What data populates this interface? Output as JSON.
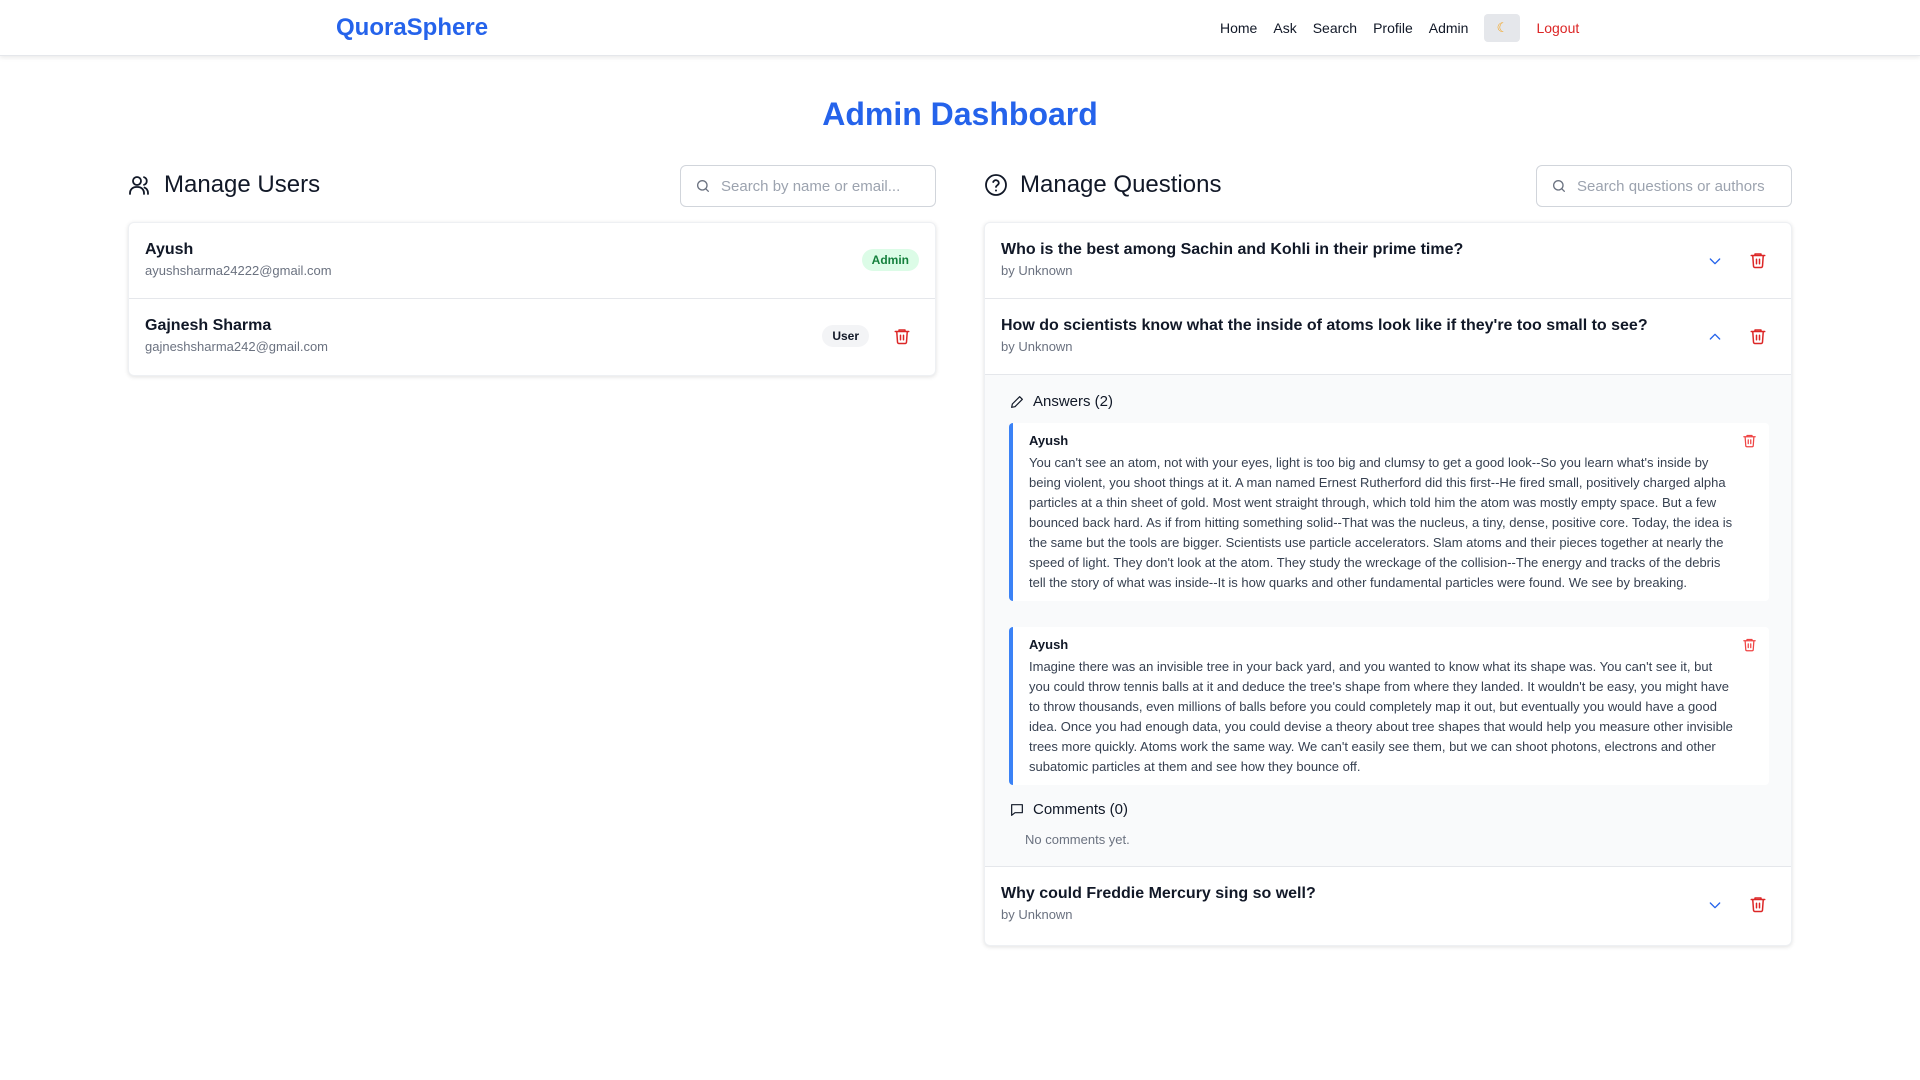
{
  "nav": {
    "brand": "QuoraSphere",
    "links": [
      "Home",
      "Ask",
      "Search",
      "Profile",
      "Admin"
    ],
    "theme_icon": "moon-icon",
    "logout": "Logout"
  },
  "page_title": "Admin Dashboard",
  "users": {
    "heading": "Manage Users",
    "search_placeholder": "Search by name or email...",
    "list": [
      {
        "name": "Ayush",
        "email": "ayushsharma24222@gmail.com",
        "role": "Admin"
      },
      {
        "name": "Gajnesh Sharma",
        "email": "gajneshsharma242@gmail.com",
        "role": "User"
      }
    ]
  },
  "questions": {
    "heading": "Manage Questions",
    "search_placeholder": "Search questions or authors",
    "list": [
      {
        "title": "Who is the best among Sachin and Kohli in their prime time?",
        "by": "by Unknown"
      },
      {
        "title": "How do scientists know what the inside of atoms look like if they're too small to see?",
        "by": "by Unknown"
      },
      {
        "title": "Why could Freddie Mercury sing so well?",
        "by": "by Unknown"
      }
    ],
    "expanded": {
      "answers_heading": "Answers (2)",
      "answers": [
        {
          "author": "Ayush",
          "text": "You can't see an atom, not with your eyes, light is too big and clumsy to get a good look--So you learn what's inside by being violent, you shoot things at it. A man named Ernest Rutherford did this first--He fired small, positively charged alpha particles at a thin sheet of gold. Most went straight through, which told him the atom was mostly empty space. But a few bounced back hard. As if from hitting something solid--That was the nucleus, a tiny, dense, positive core. Today, the idea is the same but the tools are bigger. Scientists use particle accelerators. Slam atoms and their pieces together at nearly the speed of light. They don't look at the atom. They study the wreckage of the collision--The energy and tracks of the debris tell the story of what was inside--It is how quarks and other fundamental particles were found. We see by breaking."
        },
        {
          "author": "Ayush",
          "text": "Imagine there was an invisible tree in your back yard, and you wanted to know what its shape was. You can't see it, but you could throw tennis balls at it and deduce the tree's shape from where they landed. It wouldn't be easy, you might have to throw thousands, even millions of balls before you could completely map it out, but eventually you would have a good idea. Once you had enough data, you could devise a theory about tree shapes that would help you measure other invisible trees more quickly. Atoms work the same way. We can't easily see them, but we can shoot photons, electrons and other subatomic particles at them and see how they bounce off."
        }
      ],
      "comments_heading": "Comments (0)",
      "no_comments": "No comments yet."
    }
  },
  "colors": {
    "brand": "#2563eb",
    "danger": "#dc2626",
    "admin_badge_bg": "#dcfce7",
    "answer_border": "#3b82f6"
  }
}
